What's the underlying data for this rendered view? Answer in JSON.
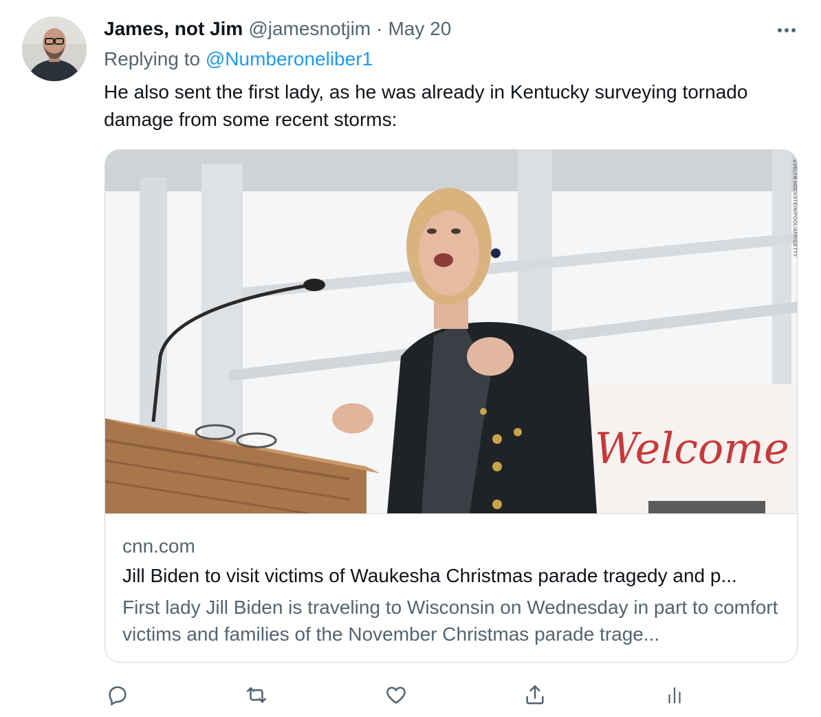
{
  "tweet": {
    "author_name": "James, not Jim",
    "author_handle": "@jamesnotjim",
    "separator": "·",
    "date": "May 20",
    "replying_prefix": "Replying to",
    "replying_to": "@Numberoneliber1",
    "text": "He also sent the first lady, as he was already in Kentucky surveying tornado damage from some recent storms:"
  },
  "card": {
    "image_credit": "EVELYN HOCKSTEIN/POOL/AFP/GETTY",
    "image_sign_text": "Welcome",
    "domain": "cnn.com",
    "title": "Jill Biden to visit victims of Waukesha Christmas parade tragedy and p...",
    "description": "First lady Jill Biden is traveling to Wisconsin on Wednesday in part to comfort victims and families of the November Christmas parade trage..."
  },
  "icons": {
    "more": "more-icon",
    "reply": "reply-icon",
    "retweet": "retweet-icon",
    "like": "like-icon",
    "share": "share-icon",
    "analytics": "analytics-icon"
  },
  "colors": {
    "text_primary": "#0f1419",
    "text_secondary": "#536471",
    "link": "#1d9bf0",
    "border": "#cfd9de"
  }
}
